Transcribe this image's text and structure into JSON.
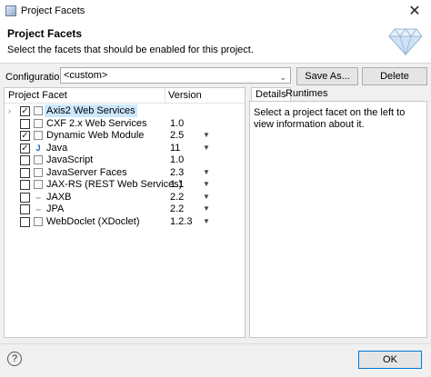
{
  "window": {
    "title": "Project Facets"
  },
  "header": {
    "title": "Project Facets",
    "description": "Select the facets that should be enabled for this project."
  },
  "configuration": {
    "label": "Configuration:",
    "value": "<custom>",
    "save_as_label": "Save As...",
    "delete_label": "Delete"
  },
  "facets": {
    "col_facet": "Project Facet",
    "col_version": "Version",
    "rows": [
      {
        "name": "Axis2 Web Services",
        "version": "",
        "checked": true,
        "selected": true,
        "expandable": true,
        "icon": "page-icon",
        "dropdown": false
      },
      {
        "name": "CXF 2.x Web Services",
        "version": "1.0",
        "checked": false,
        "selected": false,
        "expandable": false,
        "icon": "page-icon",
        "dropdown": false
      },
      {
        "name": "Dynamic Web Module",
        "version": "2.5",
        "checked": true,
        "selected": false,
        "expandable": false,
        "icon": "page-icon",
        "dropdown": true
      },
      {
        "name": "Java",
        "version": "11",
        "checked": true,
        "selected": false,
        "expandable": false,
        "icon": "java-icon",
        "dropdown": true
      },
      {
        "name": "JavaScript",
        "version": "1.0",
        "checked": false,
        "selected": false,
        "expandable": false,
        "icon": "page-icon",
        "dropdown": false
      },
      {
        "name": "JavaServer Faces",
        "version": "2.3",
        "checked": false,
        "selected": false,
        "expandable": false,
        "icon": "page-icon",
        "dropdown": true
      },
      {
        "name": "JAX-RS (REST Web Services)",
        "version": "1.1",
        "checked": false,
        "selected": false,
        "expandable": false,
        "icon": "page-icon",
        "dropdown": true
      },
      {
        "name": "JAXB",
        "version": "2.2",
        "checked": false,
        "selected": false,
        "expandable": false,
        "icon": "link-icon",
        "dropdown": true
      },
      {
        "name": "JPA",
        "version": "2.2",
        "checked": false,
        "selected": false,
        "expandable": false,
        "icon": "link-icon",
        "dropdown": true
      },
      {
        "name": "WebDoclet (XDoclet)",
        "version": "1.2.3",
        "checked": false,
        "selected": false,
        "expandable": false,
        "icon": "page-icon",
        "dropdown": true
      }
    ]
  },
  "details": {
    "tab_details": "Details",
    "tab_runtimes": "Runtimes",
    "body": "Select a project facet on the left to view information about it."
  },
  "footer": {
    "help_label": "?",
    "ok_label": "OK"
  },
  "colors": {
    "selection": "#cce8ff",
    "ok_border": "#0078d7"
  }
}
